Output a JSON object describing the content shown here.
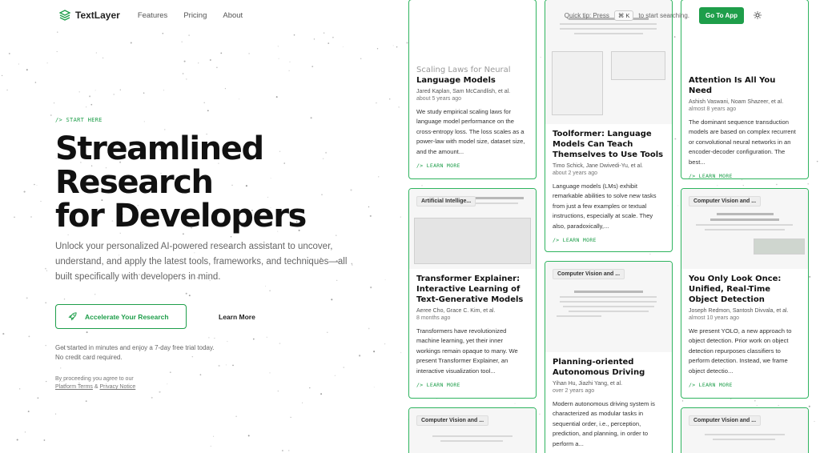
{
  "header": {
    "logo_text": "TextLayer",
    "nav": [
      "Features",
      "Pricing",
      "About"
    ],
    "quick_tip_prefix": "Quick tip: Press",
    "shortcut": "⌘ K",
    "quick_tip_suffix": "to start searching.",
    "cta": "Go To App",
    "theme_icon": "sun-icon"
  },
  "hero": {
    "eyebrow": "/> START HERE",
    "title_lines": [
      "Streamlined",
      "Research",
      "for Developers"
    ],
    "subtitle": "Unlock your personalized AI-powered research assistant to uncover, understand, and apply the latest tools, frameworks, and techniques—all built specifically with developers in mind.",
    "primary_cta": "Accelerate Your Research",
    "primary_icon": "rocket-icon",
    "secondary_cta": "Learn More",
    "trial_line1": "Get started in minutes and enjoy a 7-day free trial today.",
    "trial_line2": "No credit card required.",
    "legal_prefix": "By proceeding you agree to our",
    "legal_terms": "Platform Terms",
    "legal_and": "&",
    "legal_privacy": "Privacy Notice"
  },
  "cards": [
    {
      "title": "Language Models",
      "thumb_title": "Scaling Laws for Neural",
      "authors": "Jared Kaplan, Sam McCandlish, et al.",
      "ago": "about 5 years ago",
      "abstract": "We study empirical scaling laws for language model performance on the cross-entropy loss. The loss scales as a power-law with model size, dataset size, and the amount...",
      "more": "/> LEARN MORE"
    },
    {
      "title": "Toolformer: Language Models Can Teach Themselves to Use Tools",
      "authors": "Timo Schick, Jane Dwivedi-Yu, et al.",
      "ago": "about 2 years ago",
      "abstract": "Language models (LMs) exhibit remarkable abilities to solve new tasks from just a few examples or textual instructions, especially at scale. They also, paradoxically,...",
      "more": "/> LEARN MORE"
    },
    {
      "title": "Attention Is All You Need",
      "authors": "Ashish Vaswani, Noam Shazeer, et al.",
      "ago": "almost 8 years ago",
      "abstract": "The dominant sequence transduction models are based on complex recurrent or convolutional neural networks in an encoder-decoder configuration. The best...",
      "more": "/> LEARN MORE"
    },
    {
      "chip": "Artificial Intellige...",
      "title": "Transformer Explainer: Interactive Learning of Text-Generative Models",
      "authors": "Aeree Cho, Grace C. Kim, et al.",
      "ago": "8 months ago",
      "abstract": "Transformers have revolutionized machine learning, yet their inner workings remain opaque to many. We present Transformer Explainer, an interactive visualization tool...",
      "more": "/> LEARN MORE"
    },
    {
      "chip": "Computer Vision and ...",
      "title": "Planning-oriented Autonomous Driving",
      "authors": "Yihan Hu, Jiazhi Yang, et al.",
      "ago": "over 2 years ago",
      "abstract": "Modern autonomous driving system is characterized as modular tasks in sequential order, i.e., perception, prediction, and planning, in order to perform a...",
      "more": "/> LEARN MORE"
    },
    {
      "chip": "Computer Vision and ...",
      "title": "You Only Look Once: Unified, Real-Time Object Detection",
      "authors": "Joseph Redmon, Santosh Divvala, et al.",
      "ago": "almost 10 years ago",
      "abstract": "We present YOLO, a new approach to object detection. Prior work on object detection repurposes classifiers to perform detection. Instead, we frame object detectio...",
      "more": "/> LEARN MORE"
    },
    {
      "chip": "Computer Vision and ..."
    },
    {
      "chip": "Computer Vision and ..."
    }
  ],
  "colors": {
    "accent": "#1e9e4a",
    "card_border": "#2fb45f"
  }
}
